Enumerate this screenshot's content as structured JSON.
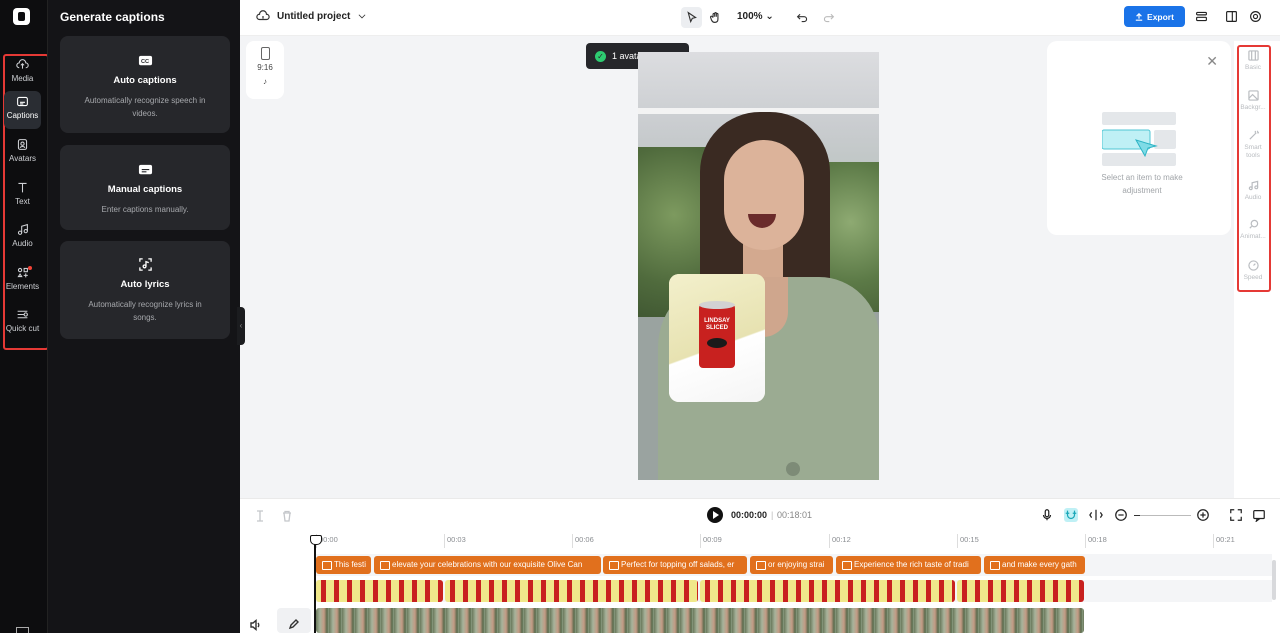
{
  "left_rail": {
    "items": [
      {
        "label": "Media",
        "icon": "cloud-upload-icon"
      },
      {
        "label": "Captions",
        "icon": "captions-icon"
      },
      {
        "label": "Avatars",
        "icon": "avatar-icon"
      },
      {
        "label": "Text",
        "icon": "text-icon"
      },
      {
        "label": "Audio",
        "icon": "music-note-icon"
      },
      {
        "label": "Elements",
        "icon": "elements-icon"
      },
      {
        "label": "Quick cut",
        "icon": "quick-cut-icon"
      }
    ],
    "active": "Captions"
  },
  "panel": {
    "title": "Generate captions",
    "cards": [
      {
        "title": "Auto captions",
        "desc": "Automatically recognize speech in videos."
      },
      {
        "title": "Manual captions",
        "desc": "Enter captions manually."
      },
      {
        "title": "Auto lyrics",
        "desc": "Automatically recognize lyrics in songs."
      }
    ]
  },
  "topbar": {
    "project_name": "Untitled project",
    "zoom": "100%",
    "export_label": "Export"
  },
  "canvas": {
    "aspect_ratio": "9:16",
    "toast": "1 avatar applied",
    "can_label": "LINDSAY SLICED"
  },
  "properties": {
    "empty_message": "Select an item to make adjustment",
    "tabs": [
      "Basic",
      "Backgr...",
      "Smart tools",
      "Audio",
      "Animat...",
      "Speed"
    ]
  },
  "timeline": {
    "current_time": "00:00:00",
    "total_time": "00:18:01",
    "ticks": [
      "00:00",
      "00:03",
      "00:06",
      "00:09",
      "00:12",
      "00:15",
      "00:18",
      "00:21"
    ],
    "captions": [
      "This festi",
      "elevate your celebrations with our exquisite Olive Can",
      "Perfect for topping off salads, er",
      "or enjoying strai",
      "Experience the rich taste of tradi",
      "and make every gath"
    ]
  },
  "colors": {
    "accent": "#1a73e8",
    "caption_clip": "#e1701d",
    "highlight": "#e53935"
  }
}
